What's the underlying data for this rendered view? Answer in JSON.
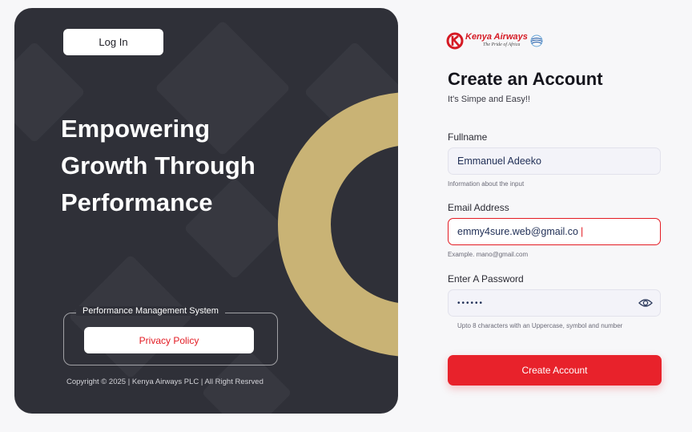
{
  "left_panel": {
    "login_label": "Log In",
    "hero_lines": [
      "Empowering",
      "Growth Through",
      "Performance"
    ],
    "pms_title": "Performance Management System",
    "privacy_label": "Privacy Policy",
    "copyright": "Copyright © 2025 | Kenya Airways PLC | All  Right Resrved"
  },
  "logo": {
    "name": "Kenya Airways",
    "tagline": "The Pride of Africa"
  },
  "form": {
    "title": "Create an Account",
    "subtitle": "It's Simpe and Easy!!",
    "fullname": {
      "label": "Fullname",
      "value": "Emmanuel Adeeko",
      "hint": "Information about the input"
    },
    "email": {
      "label": "Email Address",
      "value": "emmy4sure.web@gmail.co",
      "hint": "Example. mano@gmail.com",
      "state": "error"
    },
    "password": {
      "label": "Enter A Password",
      "value": "••••••",
      "hint": "Upto 8 characters with an Uppercase, symbol and number"
    },
    "submit_label": "Create Account"
  },
  "colors": {
    "panel_bg": "#2f3038",
    "ring": "#c9b375",
    "brand_red": "#e8222b"
  },
  "icons": [
    "kenya-airways-logo-icon",
    "skyteam-globe-icon",
    "eye-icon"
  ]
}
